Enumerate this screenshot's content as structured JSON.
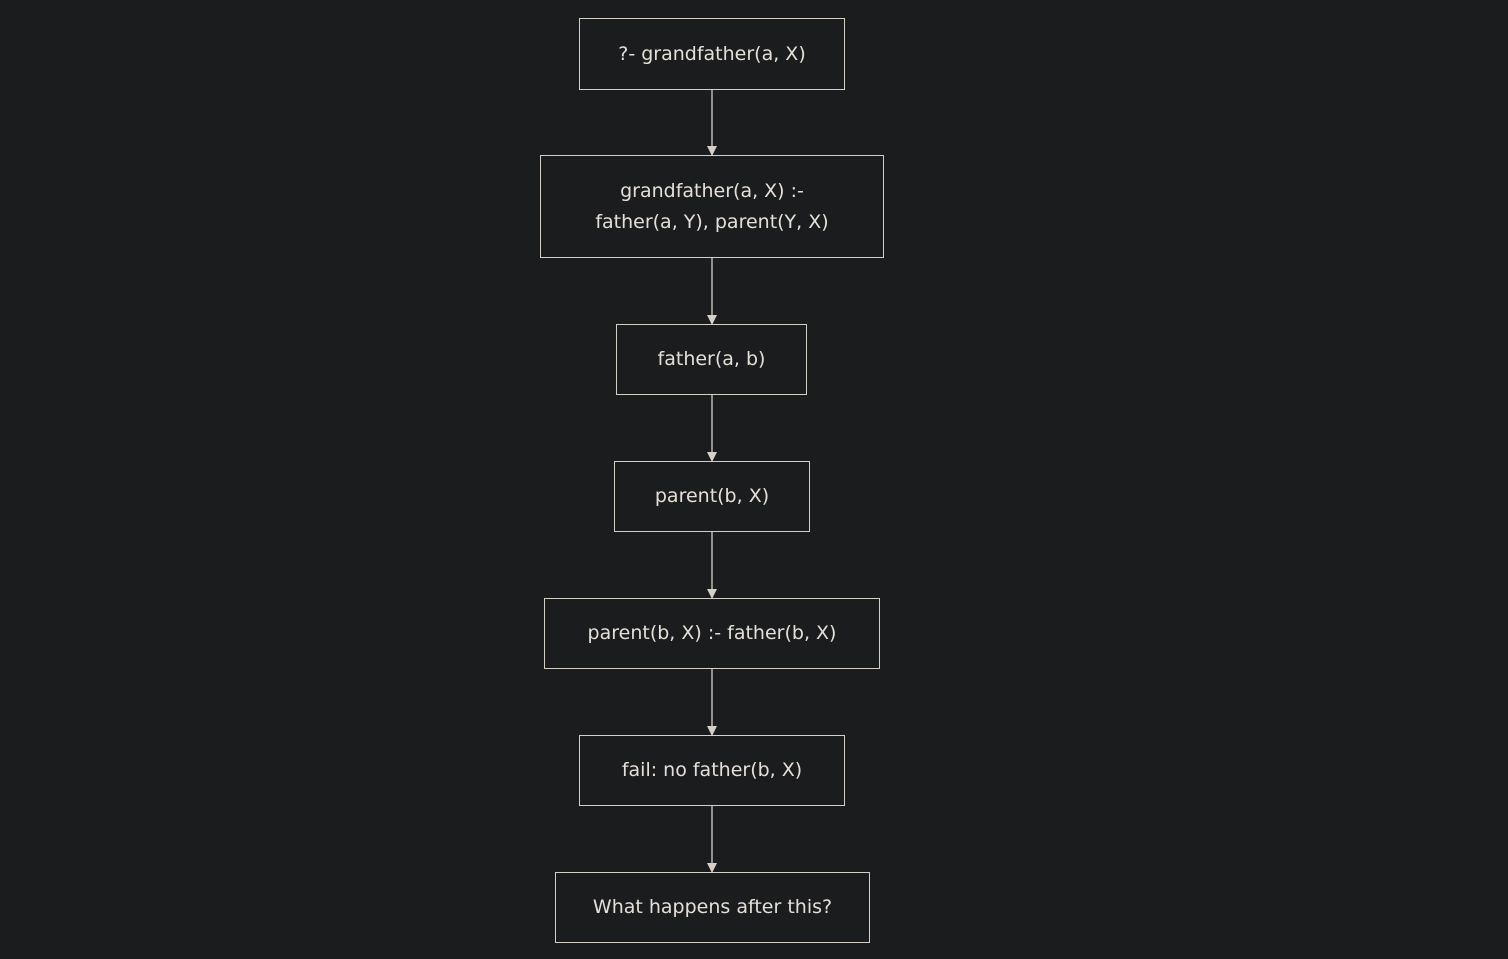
{
  "nodes": [
    {
      "id": "n1",
      "lines": [
        "?- grandfather(a, X)"
      ]
    },
    {
      "id": "n2",
      "lines": [
        "grandfather(a, X) :-",
        "father(a, Y), parent(Y, X)"
      ]
    },
    {
      "id": "n3",
      "lines": [
        "father(a, b)"
      ]
    },
    {
      "id": "n4",
      "lines": [
        "parent(b, X)"
      ]
    },
    {
      "id": "n5",
      "lines": [
        "parent(b, X) :- father(b, X)"
      ]
    },
    {
      "id": "n6",
      "lines": [
        "fail: no father(b, X)"
      ]
    },
    {
      "id": "n7",
      "lines": [
        "What happens after this?"
      ]
    }
  ],
  "edges": [
    {
      "from": "n1",
      "to": "n2"
    },
    {
      "from": "n2",
      "to": "n3"
    },
    {
      "from": "n3",
      "to": "n4"
    },
    {
      "from": "n4",
      "to": "n5"
    },
    {
      "from": "n5",
      "to": "n6"
    },
    {
      "from": "n6",
      "to": "n7"
    }
  ],
  "colors": {
    "background": "#1b1c1e",
    "stroke": "#d4d0c8",
    "text": "#e4e0d8"
  }
}
